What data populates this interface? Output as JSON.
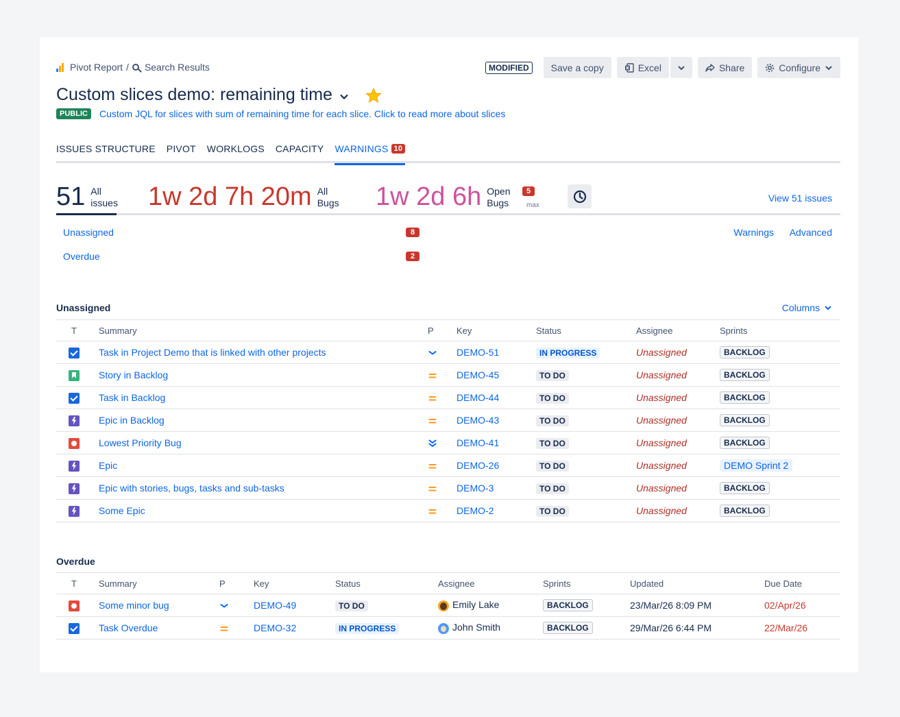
{
  "breadcrumb": {
    "pivot": "Pivot Report",
    "sep": "/",
    "search": "Search Results"
  },
  "toolbar": {
    "modified": "MODIFIED",
    "save_copy": "Save a copy",
    "excel": "Excel",
    "share": "Share",
    "configure": "Configure"
  },
  "title": "Custom slices demo: remaining time",
  "visibility": "PUBLIC",
  "description": "Custom JQL for slices with sum of remaining time for each slice. Click to read more about slices",
  "tabs": [
    {
      "label": "ISSUES STRUCTURE"
    },
    {
      "label": "PIVOT"
    },
    {
      "label": "WORKLOGS"
    },
    {
      "label": "CAPACITY"
    },
    {
      "label": "WARNINGS",
      "count": "10",
      "active": true
    }
  ],
  "stats": {
    "all_count": "51",
    "all_label_1": "All",
    "all_label_2": "issues",
    "bugs_time": "1w 2d 7h 20m",
    "bugs_label_1": "All",
    "bugs_label_2": "Bugs",
    "open_time": "1w 2d 6h",
    "open_label_1": "Open",
    "open_label_2": "Bugs",
    "open_badge": "5",
    "max_label": "max",
    "view_all": "View 51 issues"
  },
  "slices": [
    {
      "label": "Unassigned",
      "count": "8"
    },
    {
      "label": "Overdue",
      "count": "2"
    }
  ],
  "slice_links": {
    "warnings": "Warnings",
    "advanced": "Advanced"
  },
  "unassigned": {
    "title": "Unassigned",
    "columns_label": "Columns",
    "headers": {
      "t": "T",
      "summary": "Summary",
      "p": "P",
      "key": "Key",
      "status": "Status",
      "assignee": "Assignee",
      "sprints": "Sprints"
    },
    "rows": [
      {
        "type": "task",
        "summary": "Task in Project Demo that is linked with other projects",
        "priority": "low",
        "key": "DEMO-51",
        "status": "IN PROGRESS",
        "assignee": "Unassigned",
        "sprint": "BACKLOG"
      },
      {
        "type": "story",
        "summary": "Story in Backlog",
        "priority": "medium",
        "key": "DEMO-45",
        "status": "TO DO",
        "assignee": "Unassigned",
        "sprint": "BACKLOG"
      },
      {
        "type": "task",
        "summary": "Task in Backlog",
        "priority": "medium",
        "key": "DEMO-44",
        "status": "TO DO",
        "assignee": "Unassigned",
        "sprint": "BACKLOG"
      },
      {
        "type": "epic",
        "summary": "Epic in Backlog",
        "priority": "medium",
        "key": "DEMO-43",
        "status": "TO DO",
        "assignee": "Unassigned",
        "sprint": "BACKLOG"
      },
      {
        "type": "bug",
        "summary": "Lowest Priority Bug",
        "priority": "lowest",
        "key": "DEMO-41",
        "status": "TO DO",
        "assignee": "Unassigned",
        "sprint": "BACKLOG"
      },
      {
        "type": "epic",
        "summary": "Epic",
        "priority": "medium",
        "key": "DEMO-26",
        "status": "TO DO",
        "assignee": "Unassigned",
        "sprint": "DEMO Sprint 2"
      },
      {
        "type": "epic",
        "summary": "Epic with stories, bugs, tasks and sub-tasks",
        "priority": "medium",
        "key": "DEMO-3",
        "status": "TO DO",
        "assignee": "Unassigned",
        "sprint": "BACKLOG"
      },
      {
        "type": "epic",
        "summary": "Some Epic",
        "priority": "medium",
        "key": "DEMO-2",
        "status": "TO DO",
        "assignee": "Unassigned",
        "sprint": "BACKLOG"
      }
    ]
  },
  "overdue": {
    "title": "Overdue",
    "headers": {
      "t": "T",
      "summary": "Summary",
      "p": "P",
      "key": "Key",
      "status": "Status",
      "assignee": "Assignee",
      "sprints": "Sprints",
      "updated": "Updated",
      "due": "Due Date"
    },
    "rows": [
      {
        "type": "bug",
        "summary": "Some minor bug",
        "priority": "low",
        "key": "DEMO-49",
        "status": "TO DO",
        "assignee": "Emily Lake",
        "sprint": "BACKLOG",
        "updated": "23/Mar/26 8:09 PM",
        "due": "02/Apr/26"
      },
      {
        "type": "task",
        "summary": "Task Overdue",
        "priority": "medium",
        "key": "DEMO-32",
        "status": "IN PROGRESS",
        "assignee": "John Smith",
        "sprint": "BACKLOG",
        "updated": "29/Mar/26 6:44 PM",
        "due": "22/Mar/26"
      }
    ]
  },
  "colors": {
    "link": "#0c66e4",
    "danger": "#c9372c",
    "open_bugs": "#cd519d",
    "public": "#1f845a",
    "priority_medium": "#ff991f",
    "priority_low": "#0065ff"
  }
}
